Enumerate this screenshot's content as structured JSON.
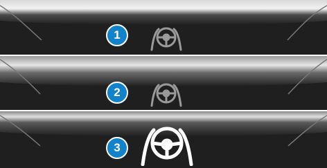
{
  "steps": [
    {
      "number": "1",
      "icon": "hands-on-steering-wheel-icon",
      "state": "dim"
    },
    {
      "number": "2",
      "icon": "hands-on-steering-wheel-icon",
      "state": "dim"
    },
    {
      "number": "3",
      "icon": "hands-on-steering-wheel-icon",
      "state": "highlighted"
    }
  ],
  "colors": {
    "background": "#1f1f1f",
    "badge": "#1482c8",
    "icon_dim": "#9a9a9a",
    "icon_bright": "#ffffff"
  }
}
